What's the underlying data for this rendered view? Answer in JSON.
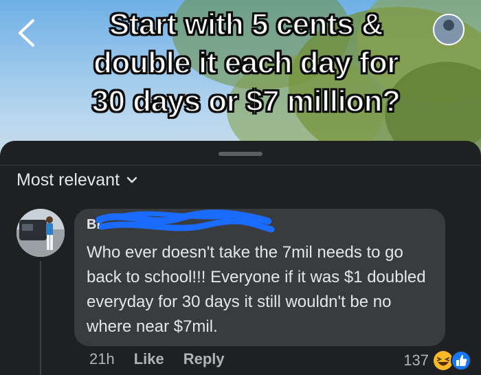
{
  "video": {
    "headline_lines": [
      "Start with 5 cents &",
      "double it each day for",
      "30 days or $7 million?"
    ]
  },
  "icons": {
    "back": "chevron-left-icon",
    "sort": "chevron-down-icon",
    "haha": "laughing-reaction-icon",
    "like": "like-reaction-icon"
  },
  "comments_panel": {
    "sort_label": "Most relevant"
  },
  "comment": {
    "author": "Br",
    "text": "Who ever doesn't take the 7mil needs to go back to school!!! Everyone if it was $1 doubled everyday for 30 days it still wouldn't be no where near $7mil.",
    "time": "21h",
    "like_label": "Like",
    "reply_label": "Reply",
    "reaction_count": "137"
  },
  "colors": {
    "sheet_bg": "#1f2022",
    "bubble_bg": "#3a3b3c",
    "text_primary": "#e4e6eb",
    "text_secondary": "#b0b3b8",
    "redaction": "#1a6bff",
    "like_blue": "#1877f2",
    "haha_yellow": "#f7b928"
  }
}
